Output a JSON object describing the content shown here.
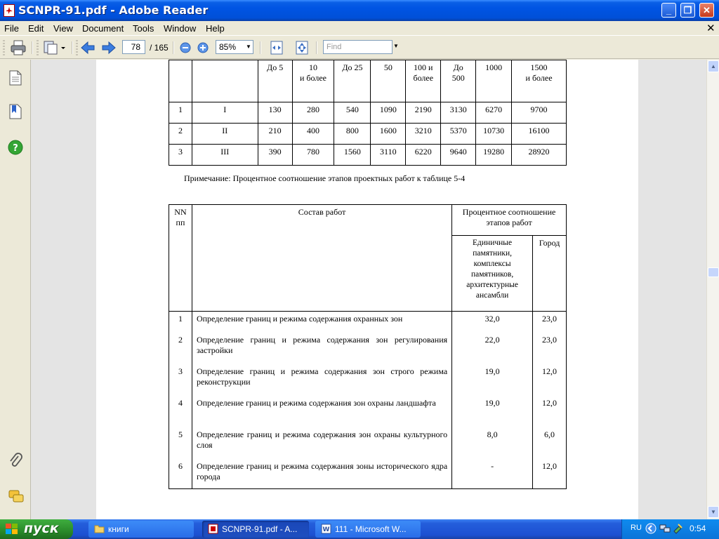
{
  "window": {
    "title": "SCNPR-91.pdf - Adobe Reader"
  },
  "menu": [
    "File",
    "Edit",
    "View",
    "Document",
    "Tools",
    "Window",
    "Help"
  ],
  "toolbar": {
    "page_current": "78",
    "page_total": "/ 165",
    "zoom": "85%",
    "find_placeholder": "Find"
  },
  "table1": {
    "header": [
      "До 5",
      "10\nи более",
      "До 25",
      "50",
      "100 и\nболее",
      "До\n500",
      "1000",
      "1500\nи более"
    ],
    "rows": [
      {
        "n": "1",
        "cat": "I",
        "vals": [
          "130",
          "280",
          "540",
          "1090",
          "2190",
          "3130",
          "6270",
          "9700"
        ]
      },
      {
        "n": "2",
        "cat": "II",
        "vals": [
          "210",
          "400",
          "800",
          "1600",
          "3210",
          "5370",
          "10730",
          "16100"
        ]
      },
      {
        "n": "3",
        "cat": "III",
        "vals": [
          "390",
          "780",
          "1560",
          "3110",
          "6220",
          "9640",
          "19280",
          "28920"
        ]
      }
    ]
  },
  "note": "Примечание: Процентное соотношение этапов проектных работ к таблице 5-4",
  "table2": {
    "h_num": "NN\nпп",
    "h_work": "Состав работ",
    "h_pct": "Процентное соотношение\nэтапов работ",
    "h_col1": "Единичные\nпамятники,\nкомплексы\nпамятников,\nархитектурные\nансамбли",
    "h_col2": "Город",
    "rows": [
      {
        "n": "1",
        "text": "Определение границ и режима содержания охранных зон",
        "a": "32,0",
        "b": "23,0"
      },
      {
        "n": "2",
        "text": "Определение границ и режима содержания зон регулирования застройки",
        "a": "22,0",
        "b": "23,0"
      },
      {
        "n": "3",
        "text": "Определение границ и режима содержания зон строго режима реконструкции",
        "a": "19,0",
        "b": "12,0"
      },
      {
        "n": "4",
        "text": "Определение границ и режима содержания зон охраны ландшафта",
        "a": "19,0",
        "b": "12,0"
      },
      {
        "n": "5",
        "text": "Определение границ и режима содержания зон охраны культурного слоя",
        "a": "8,0",
        "b": "6,0"
      },
      {
        "n": "6",
        "text": "Определение границ и режима содержания зоны исторического ядра города",
        "a": "-",
        "b": "12,0"
      }
    ]
  },
  "taskbar": {
    "start": "пуск",
    "tasks": [
      "книги",
      "SCNPR-91.pdf - A...",
      "111 - Microsoft W..."
    ],
    "lang": "RU",
    "clock": "0:54"
  }
}
